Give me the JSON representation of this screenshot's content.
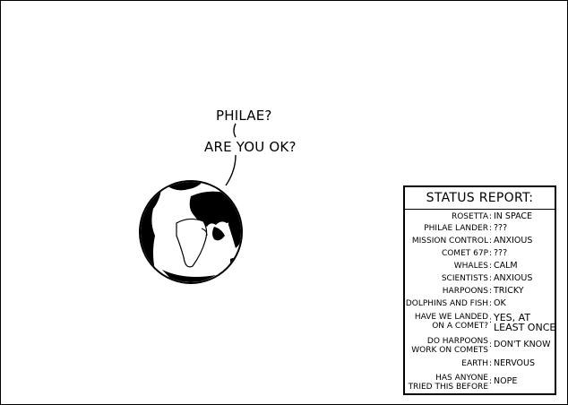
{
  "speech": {
    "line1": "PHILAE?",
    "line2": "ARE YOU OK?"
  },
  "status_report": {
    "title": "STATUS REPORT:",
    "rows": [
      {
        "label": [
          "ROSETTA"
        ],
        "value": [
          "IN SPACE"
        ]
      },
      {
        "label": [
          "PHILAE LANDER"
        ],
        "value": [
          "???"
        ]
      },
      {
        "label": [
          "MISSION CONTROL"
        ],
        "value": [
          "ANXIOUS"
        ]
      },
      {
        "label": [
          "COMET 67P"
        ],
        "value": [
          "???"
        ]
      },
      {
        "label": [
          "WHALES"
        ],
        "value": [
          "CALM"
        ]
      },
      {
        "label": [
          "SCIENTISTS"
        ],
        "value": [
          "ANXIOUS"
        ]
      },
      {
        "label": [
          "HARPOONS"
        ],
        "value": [
          "TRICKY"
        ]
      },
      {
        "label": [
          "DOLPHINS AND FISH"
        ],
        "value": [
          "OK"
        ]
      },
      {
        "label": [
          "HAVE WE LANDED",
          "ON A COMET?"
        ],
        "value": [
          "YES, AT",
          "LEAST ONCE"
        ]
      },
      {
        "label": [
          "DO HARPOONS",
          "WORK ON COMETS"
        ],
        "value": [
          "DON'T KNOW"
        ]
      },
      {
        "label": [
          "EARTH"
        ],
        "value": [
          "NERVOUS"
        ]
      },
      {
        "label": [
          "HAS ANYONE",
          "TRIED THIS BEFORE"
        ],
        "value": [
          "NOPE"
        ]
      }
    ]
  }
}
